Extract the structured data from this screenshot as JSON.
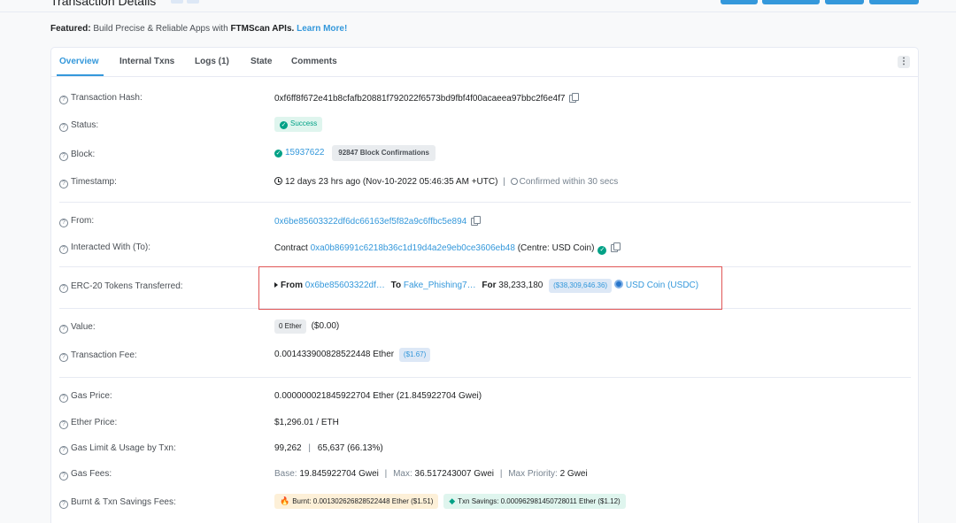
{
  "page": {
    "title": "Transaction Details"
  },
  "featured": {
    "prefix": "Featured:",
    "text": "Build Precise & Reliable Apps with",
    "brand": "FTMScan APIs.",
    "link": "Learn More!"
  },
  "tabs": [
    "Overview",
    "Internal Txns",
    "Logs (1)",
    "State",
    "Comments"
  ],
  "more_label": "⋮",
  "tx": {
    "hash_label": "Transaction Hash:",
    "hash": "0xf6ff8f672e41b8cfafb20881f792022f6573bd9fbf4f00acaeea97bbc2f6e4f7",
    "status_label": "Status:",
    "status": "Success",
    "block_label": "Block:",
    "block": "15937622",
    "confirmations": "92847 Block Confirmations",
    "timestamp_label": "Timestamp:",
    "timestamp": "12 days 23 hrs ago (Nov-10-2022 05:46:35 AM +UTC)",
    "timestamp_sep": "|",
    "confirmed": "Confirmed within 30 secs",
    "from_label": "From:",
    "from": "0x6be85603322df6dc66163ef5f82a9c6ffbc5e894",
    "to_label": "Interacted With (To):",
    "to_prefix": "Contract",
    "to": "0xa0b86991c6218b36c1d19d4a2e9eb0ce3606eb48",
    "to_name": "(Centre: USD Coin)",
    "erc20_label": "ERC-20 Tokens Transferred:",
    "erc20": {
      "from_kw": "From",
      "from": "0x6be85603322df…",
      "to_kw": "To",
      "to": "Fake_Phishing7…",
      "for_kw": "For",
      "amount": "38,233,180",
      "usd": "($38,309,646.36)",
      "token": "USD Coin (USDC)"
    },
    "value_label": "Value:",
    "value": "0 Ether",
    "value_usd": "($0.00)",
    "fee_label": "Transaction Fee:",
    "fee": "0.001433900828522448 Ether",
    "fee_usd": "($1.67)",
    "gas_price_label": "Gas Price:",
    "gas_price": "0.000000021845922704 Ether (21.845922704 Gwei)",
    "ether_price_label": "Ether Price:",
    "ether_price": "$1,296.01 / ETH",
    "gas_limit_label": "Gas Limit & Usage by Txn:",
    "gas_limit": "99,262",
    "gas_limit_sep": "|",
    "gas_usage": "65,637 (66.13%)",
    "gas_fees_label": "Gas Fees:",
    "gas_fees": {
      "base_kw": "Base:",
      "base": "19.845922704 Gwei",
      "sep1": "|",
      "max_kw": "Max:",
      "max": "36.517243007 Gwei",
      "sep2": "|",
      "prio_kw": "Max Priority:",
      "prio": "2 Gwei"
    },
    "burnt_label": "Burnt & Txn Savings Fees:",
    "burnt": "Burnt: 0.001302626828522448 Ether ($1.51)",
    "savings": "Txn Savings: 0.000962981450728011 Ether ($1.12)"
  },
  "colors": {
    "accent": "#3498db",
    "success": "#00a186",
    "highlight": "#e05656"
  }
}
